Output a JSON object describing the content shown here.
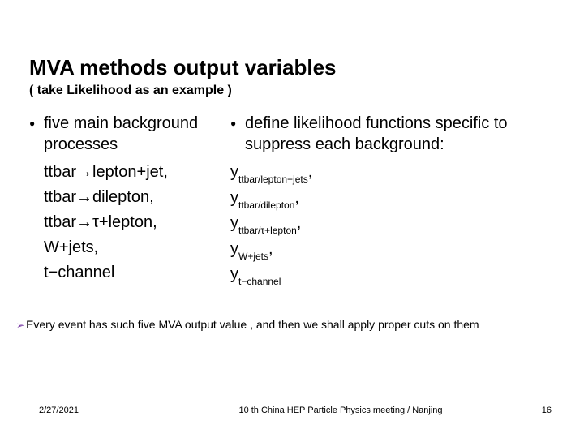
{
  "title": "MVA methods output variables",
  "subtitle": "( take Likelihood as an example )",
  "left": {
    "intro": "five main background processes",
    "items": [
      "ttbar→lepton+jet,",
      "ttbar→dilepton,",
      "ttbar→τ+lepton,",
      "W+jets,",
      "t−channel"
    ]
  },
  "right": {
    "intro": "define likelihood functions specific to suppress each background:",
    "vars": [
      {
        "sub": "ttbar/lepton+jets",
        "tail": ","
      },
      {
        "sub": "ttbar/dilepton",
        "tail": ","
      },
      {
        "sub": "ttbar/τ+lepton",
        "tail": ","
      },
      {
        "sub": "W+jets",
        "tail": ","
      },
      {
        "sub": "t−channel",
        "tail": ""
      }
    ]
  },
  "note_prefix": "Every",
  "note_rest": " event has such five MVA output value , and then we shall apply proper cuts on them",
  "footer": {
    "date": "2/27/2021",
    "center": "10 th China HEP Particle Physics meeting / Nanjing",
    "page": "16"
  }
}
